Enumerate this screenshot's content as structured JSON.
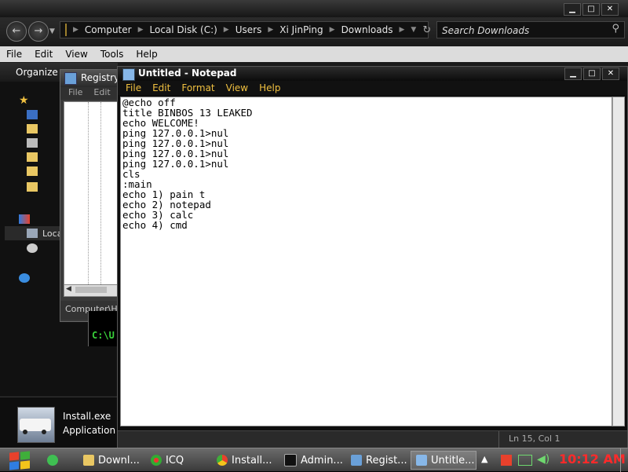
{
  "explorer": {
    "breadcrumbs": [
      "Computer",
      "Local Disk (C:)",
      "Users",
      "Xi JinPing",
      "Downloads"
    ],
    "search_placeholder": "Search Downloads",
    "menu": [
      "File",
      "Edit",
      "View",
      "Tools",
      "Help"
    ],
    "toolbar": {
      "organize": "Organize"
    },
    "sidebar": {
      "local_label": "Loca"
    },
    "details": {
      "file_name": "Install.exe",
      "type_prefix": "D",
      "type": "Application"
    }
  },
  "registry": {
    "title": "Registry",
    "menu": [
      "File",
      "Edit"
    ],
    "status": "Computer\\HK"
  },
  "cmd": {
    "prompt": "C:\\U"
  },
  "notepad": {
    "title": "Untitled - Notepad",
    "menu": [
      "File",
      "Edit",
      "Format",
      "View",
      "Help"
    ],
    "content": "@echo off\ntitle BINBOS 13 LEAKED\necho WELCOME!\nping 127.0.0.1>nul\nping 127.0.0.1>nul\nping 127.0.0.1>nul\nping 127.0.0.1>nul\ncls\n:main\necho 1) pain t\necho 2) notepad\necho 3) calc\necho 4) cmd\n\n",
    "status": "Ln 15, Col 1"
  },
  "taskbar": {
    "items": [
      {
        "label": "Downl...",
        "icon": "folder-icon"
      },
      {
        "label": "ICQ",
        "icon": "icq-flower-icon"
      },
      {
        "label": "Install...",
        "icon": "chrome-icon"
      },
      {
        "label": "Admin...",
        "icon": "cmd-icon"
      },
      {
        "label": "Regist...",
        "icon": "regedit-icon"
      },
      {
        "label": "Untitle...",
        "icon": "notepad-icon"
      }
    ],
    "clock": "10:12 AM"
  },
  "colors": {
    "notepad_menu": "#f0c040",
    "clock": "#ff2a2a",
    "windows_red": "#e8412c",
    "windows_green": "#3fae3a",
    "windows_blue": "#2f7de1",
    "windows_yellow": "#f3c41b"
  }
}
